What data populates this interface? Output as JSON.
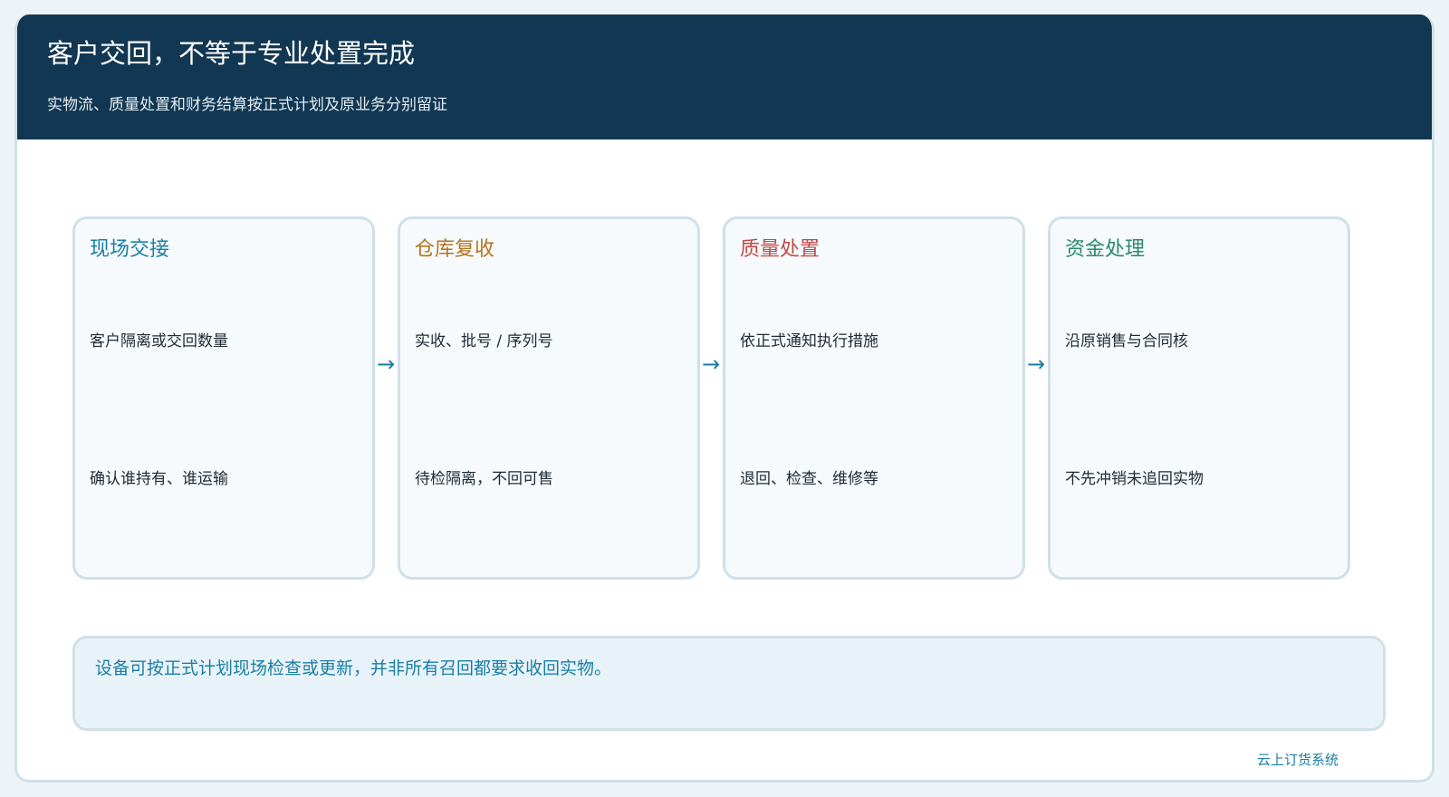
{
  "header": {
    "title": "客户交回，不等于专业处置完成",
    "subtitle": "实物流、质量处置和财务结算按正式计划及原业务分别留证"
  },
  "flow": {
    "arrow": "→",
    "steps": [
      {
        "title": "现场交接",
        "color": "#1a7fa5",
        "line1": "客户隔离或交回数量",
        "line2": "确认谁持有、谁运输"
      },
      {
        "title": "仓库复收",
        "color": "#b5741e",
        "line1": "实收、批号 / 序列号",
        "line2": "待检隔离，不回可售"
      },
      {
        "title": "质量处置",
        "color": "#c24a4a",
        "line1": "依正式通知执行措施",
        "line2": "退回、检查、维修等"
      },
      {
        "title": "资金处理",
        "color": "#2a8a6a",
        "line1": "沿原销售与合同核",
        "line2": "不先冲销未追回实物"
      }
    ]
  },
  "note": {
    "text": "设备可按正式计划现场检查或更新，并非所有召回都要求收回实物。"
  },
  "footer": {
    "brand": "云上订货系统"
  },
  "colors": {
    "header_bg": "#123752",
    "accent": "#1a7fa5",
    "border": "#cfe0e8"
  }
}
